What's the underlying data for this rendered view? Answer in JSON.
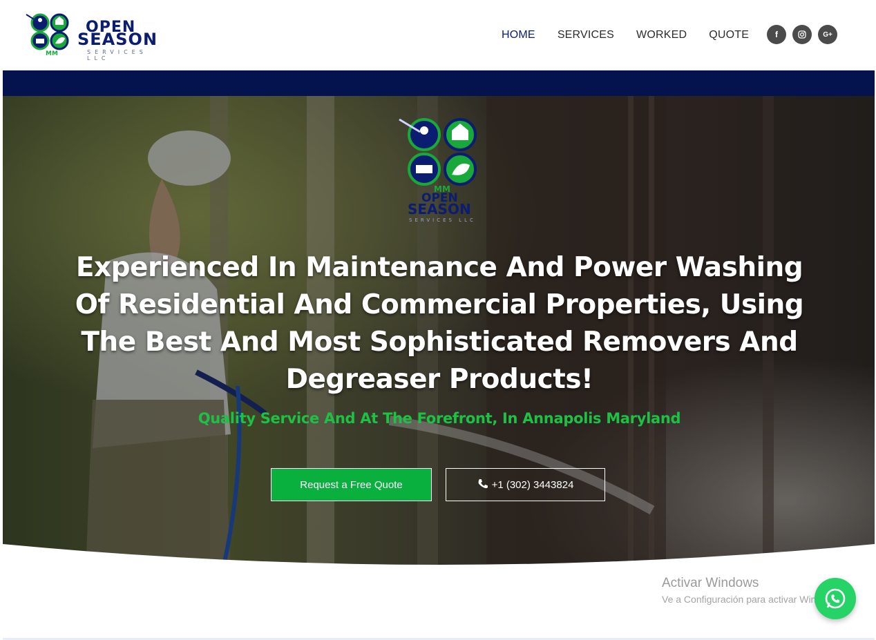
{
  "header": {
    "logo": {
      "line1": "OPEN",
      "line2": "SEASON",
      "line3": "SERVICES LLC",
      "badge": "MM"
    },
    "nav": [
      {
        "label": "HOME",
        "active": true
      },
      {
        "label": "SERVICES",
        "active": false
      },
      {
        "label": "WORKED",
        "active": false
      },
      {
        "label": "QUOTE",
        "active": false
      }
    ],
    "social": [
      {
        "icon": "facebook-icon",
        "glyph": "f"
      },
      {
        "icon": "instagram-icon",
        "glyph": "◎"
      },
      {
        "icon": "google-plus-icon",
        "glyph": "G+"
      }
    ]
  },
  "hero": {
    "headline": "Experienced In Maintenance And Power Washing Of Residential And Commercial Properties, Using The Best And Most Sophisticated Removers And Degreaser Products!",
    "subline": "Quality Service And At The Forefront, In Annapolis Maryland",
    "quote_button": "Request a Free Quote",
    "phone_button": "+1 (302) 3443824",
    "logo": {
      "line1": "OPEN",
      "line2": "SEASON",
      "line3": "SERVICES LLC",
      "badge": "MM"
    }
  },
  "watermark": {
    "title": "Activar Windows",
    "subtitle": "Ve a Configuración para activar Windows."
  },
  "colors": {
    "navy": "#04124d",
    "green": "#0ab03e",
    "subline_green": "#1dc245",
    "whatsapp": "#25d366"
  }
}
